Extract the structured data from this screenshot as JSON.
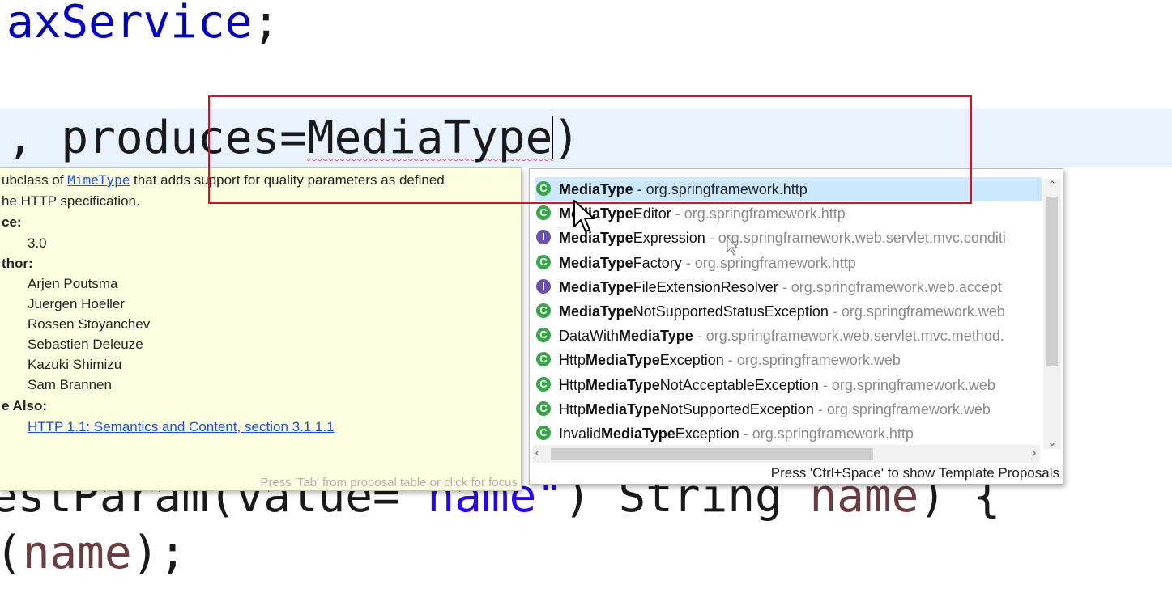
{
  "editor": {
    "line1_text": "axService",
    "line1_semi": ";",
    "current_line_prefix": ", produces=",
    "current_line_typed": "MediaType",
    "current_line_close": ")",
    "line_param_a": "estParam(value=",
    "line_param_str": "\"name\"",
    "line_param_b": ") String ",
    "line_param_var": "name",
    "line_param_c": ") {",
    "line_call_a": "(",
    "line_call_var": "name",
    "line_call_b": ");"
  },
  "javadoc": {
    "line1_pre": "ubclass of ",
    "line1_link": "MimeType",
    "line1_post": " that adds support for quality parameters as defined",
    "line2": "he HTTP specification.",
    "since_label": "ce:",
    "since_value": "3.0",
    "author_label": "thor:",
    "authors": [
      "Arjen Poutsma",
      "Juergen Hoeller",
      "Rossen Stoyanchev",
      "Sebastien Deleuze",
      "Kazuki Shimizu",
      "Sam Brannen"
    ],
    "see_label": "e Also:",
    "see_link": "HTTP 1.1: Semantics and Content, section 3.1.1.1",
    "footer": "Press 'Tab' from proposal table or click for focus"
  },
  "assist": {
    "proposals": [
      {
        "pre": "",
        "hl": "MediaType",
        "post": "",
        "pkg": " - org.springframework.http",
        "kind": "class"
      },
      {
        "pre": "",
        "hl": "MediaType",
        "post": "Editor",
        "pkg": " - org.springframework.http",
        "kind": "class"
      },
      {
        "pre": "",
        "hl": "MediaType",
        "post": "Expression",
        "pkg": " - org.springframework.web.servlet.mvc.conditi",
        "kind": "interface"
      },
      {
        "pre": "",
        "hl": "MediaType",
        "post": "Factory",
        "pkg": " - org.springframework.http",
        "kind": "class"
      },
      {
        "pre": "",
        "hl": "MediaType",
        "post": "FileExtensionResolver",
        "pkg": " - org.springframework.web.accept",
        "kind": "interface"
      },
      {
        "pre": "",
        "hl": "MediaType",
        "post": "NotSupportedStatusException",
        "pkg": " - org.springframework.web",
        "kind": "class"
      },
      {
        "pre": "DataWith",
        "hl": "MediaType",
        "post": "",
        "pkg": " - org.springframework.web.servlet.mvc.method.",
        "kind": "class"
      },
      {
        "pre": "Http",
        "hl": "MediaType",
        "post": "Exception",
        "pkg": " - org.springframework.web",
        "kind": "class"
      },
      {
        "pre": "Http",
        "hl": "MediaType",
        "post": "NotAcceptableException",
        "pkg": " - org.springframework.web",
        "kind": "class"
      },
      {
        "pre": "Http",
        "hl": "MediaType",
        "post": "NotSupportedException",
        "pkg": " - org.springframework.web",
        "kind": "class"
      },
      {
        "pre": "Invalid",
        "hl": "MediaType",
        "post": "Exception",
        "pkg": " - org.springframework.http",
        "kind": "class"
      }
    ],
    "footer": "Press 'Ctrl+Space' to show Template Proposals",
    "icons": {
      "class": "C",
      "interface": "I"
    }
  },
  "colors": {
    "highlight_box": "#e01010",
    "selection": "#cce8ff",
    "javadoc_bg": "#ffffe1",
    "current_line": "#e8f2fe"
  }
}
